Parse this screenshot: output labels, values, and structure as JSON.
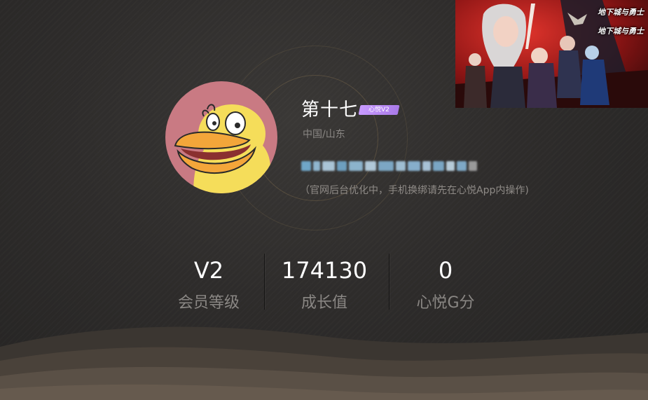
{
  "profile": {
    "username": "第十七",
    "vip_badge": "心悦V2",
    "location": "中国/山东",
    "notice": "（官网后台优化中，手机换绑请先在心悦App内操作)"
  },
  "stats": [
    {
      "value": "V2",
      "label": "会员等级"
    },
    {
      "value": "174130",
      "label": "成长值"
    },
    {
      "value": "0",
      "label": "心悦G分"
    }
  ],
  "banner": {
    "logo_top": "地下城与勇士",
    "logo_bottom": "地下城与勇士"
  },
  "colors": {
    "background": "#2e2c2b",
    "vip_badge": "#b98af0",
    "accent_ring": "#aa8c5f",
    "muted_text": "#8a8784"
  },
  "icons": {
    "avatar": "duck-avatar",
    "blurred_phone": "redacted-phone-number"
  }
}
